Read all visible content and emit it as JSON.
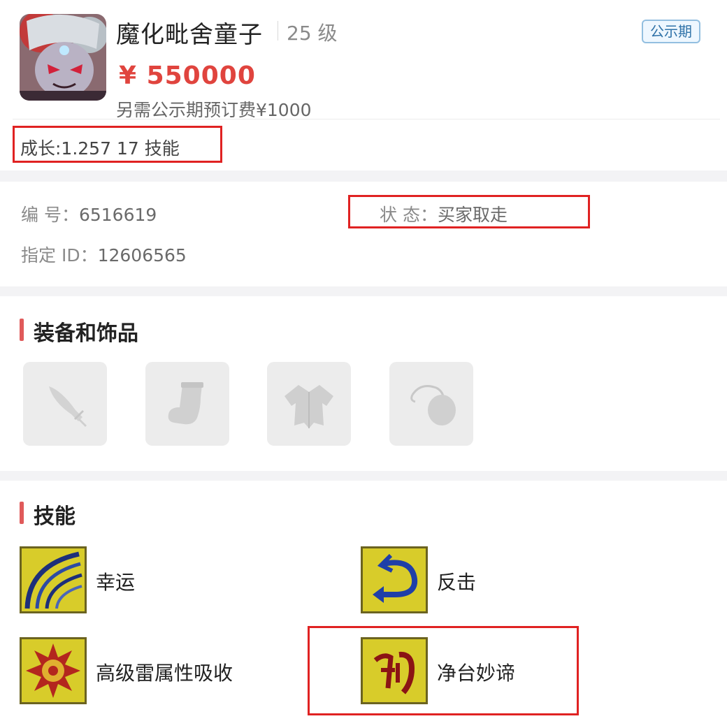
{
  "header": {
    "name": "魔化毗舍童子",
    "level": "25 级",
    "badge": "公示期",
    "price": "¥ 550000",
    "fee": "另需公示期预订费¥1000",
    "growth": "成长:1.257 17 技能"
  },
  "info": {
    "number_label": "编 号：",
    "number_value": "6516619",
    "id_label": "指定 ID：",
    "id_value": "12606565",
    "status_label": "状 态：",
    "status_value": "买家取走"
  },
  "equipment": {
    "title": "装备和饰品",
    "slots": [
      {
        "icon": "sword-icon"
      },
      {
        "icon": "boot-icon"
      },
      {
        "icon": "armor-icon"
      },
      {
        "icon": "amulet-icon"
      }
    ]
  },
  "skills": {
    "title": "技能",
    "items": [
      {
        "label": "幸运",
        "icon": "luck-skill-icon"
      },
      {
        "label": "反击",
        "icon": "counterattack-skill-icon"
      },
      {
        "label": "高级雷属性吸收",
        "icon": "thunder-absorb-skill-icon"
      },
      {
        "label": "净台妙谛",
        "icon": "jingtai-skill-icon"
      }
    ]
  },
  "colors": {
    "price": "#e0443e",
    "highlight_box": "#e02222",
    "section_accent": "#e05a5a",
    "badge_border": "#93bfe0"
  }
}
